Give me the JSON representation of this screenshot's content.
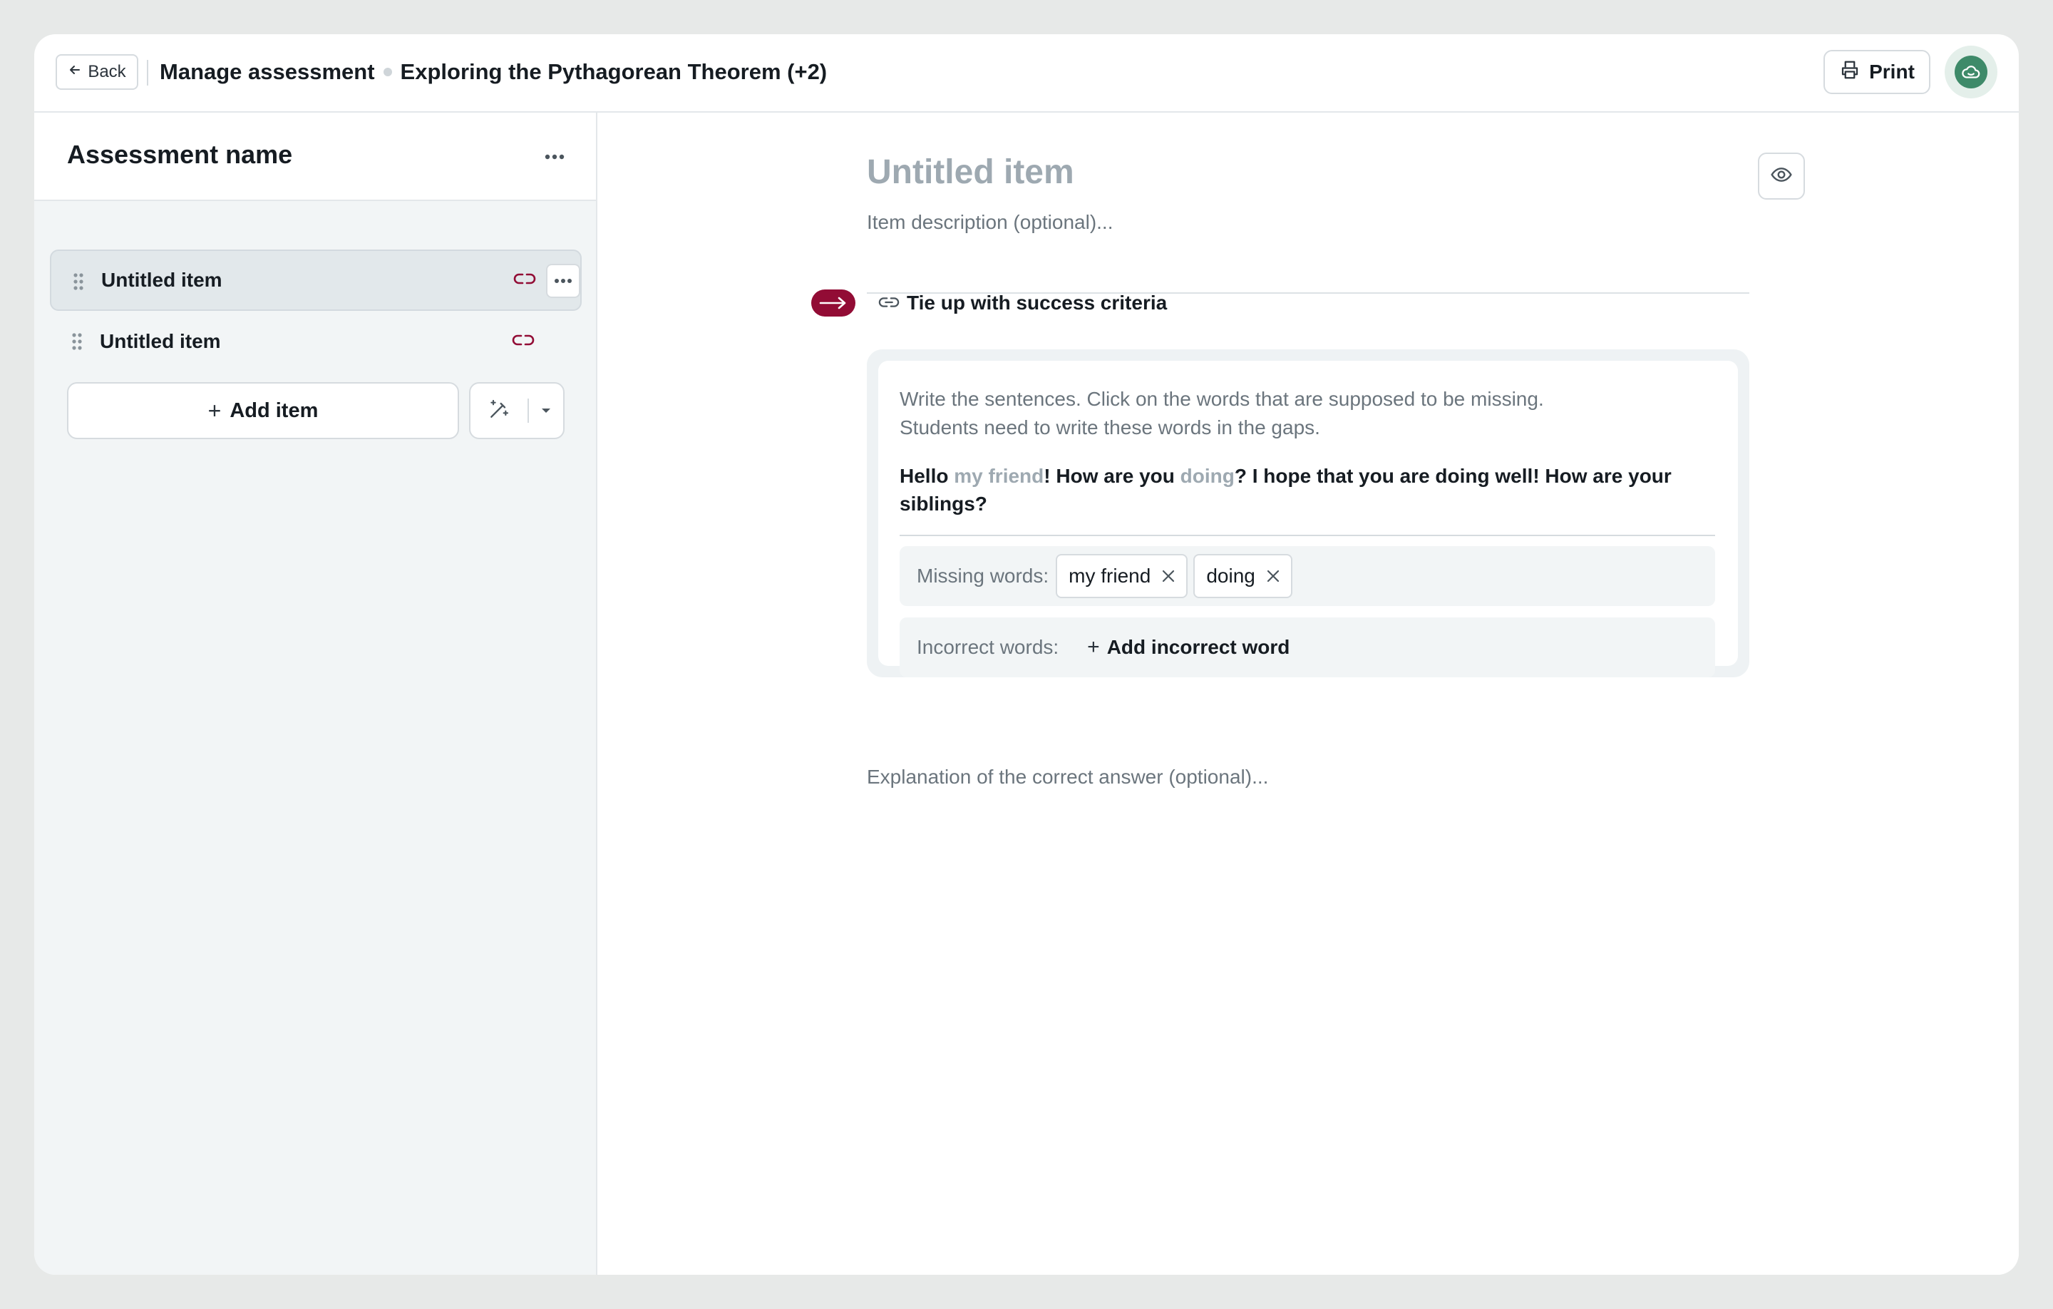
{
  "header": {
    "back_label": "Back",
    "section": "Manage assessment",
    "assessment_title": "Exploring the Pythagorean Theorem (+2)",
    "print_label": "Print"
  },
  "sidebar": {
    "title": "Assessment name",
    "items": [
      {
        "label": "Untitled item",
        "selected": true
      },
      {
        "label": "Untitled item",
        "selected": false
      }
    ],
    "add_item_label": "Add item"
  },
  "editor": {
    "title_placeholder": "Untitled item",
    "description_placeholder": "Item description (optional)...",
    "criteria_label": "Tie up with success criteria",
    "instructions_line1": "Write the sentences. Click on the words that are supposed to be missing.",
    "instructions_line2": "Students need to write these words in the gaps.",
    "sentence": {
      "part1": "Hello ",
      "gap1": "my friend",
      "part2": "! How are you ",
      "gap2": "doing",
      "part3": "? I hope that you are doing well! How are your siblings?"
    },
    "missing_words_label": "Missing words:",
    "missing_words": [
      "my friend",
      "doing"
    ],
    "incorrect_words_label": "Incorrect words:",
    "add_incorrect_label": "Add incorrect word",
    "explanation_placeholder": "Explanation of the correct answer (optional)..."
  },
  "colors": {
    "accent": "#920c35",
    "avatar": "#3e8a69",
    "placeholder": "#9ea9b1",
    "sidebar_bg": "#f2f5f6"
  },
  "icons": [
    "arrow-left-icon",
    "printer-icon",
    "cloud-avatar-icon",
    "more-horizontal-icon",
    "drag-handle-icon",
    "link-icon",
    "plus-icon",
    "magic-wand-icon",
    "caret-down-icon",
    "eye-icon",
    "arrow-right-icon",
    "close-icon"
  ]
}
